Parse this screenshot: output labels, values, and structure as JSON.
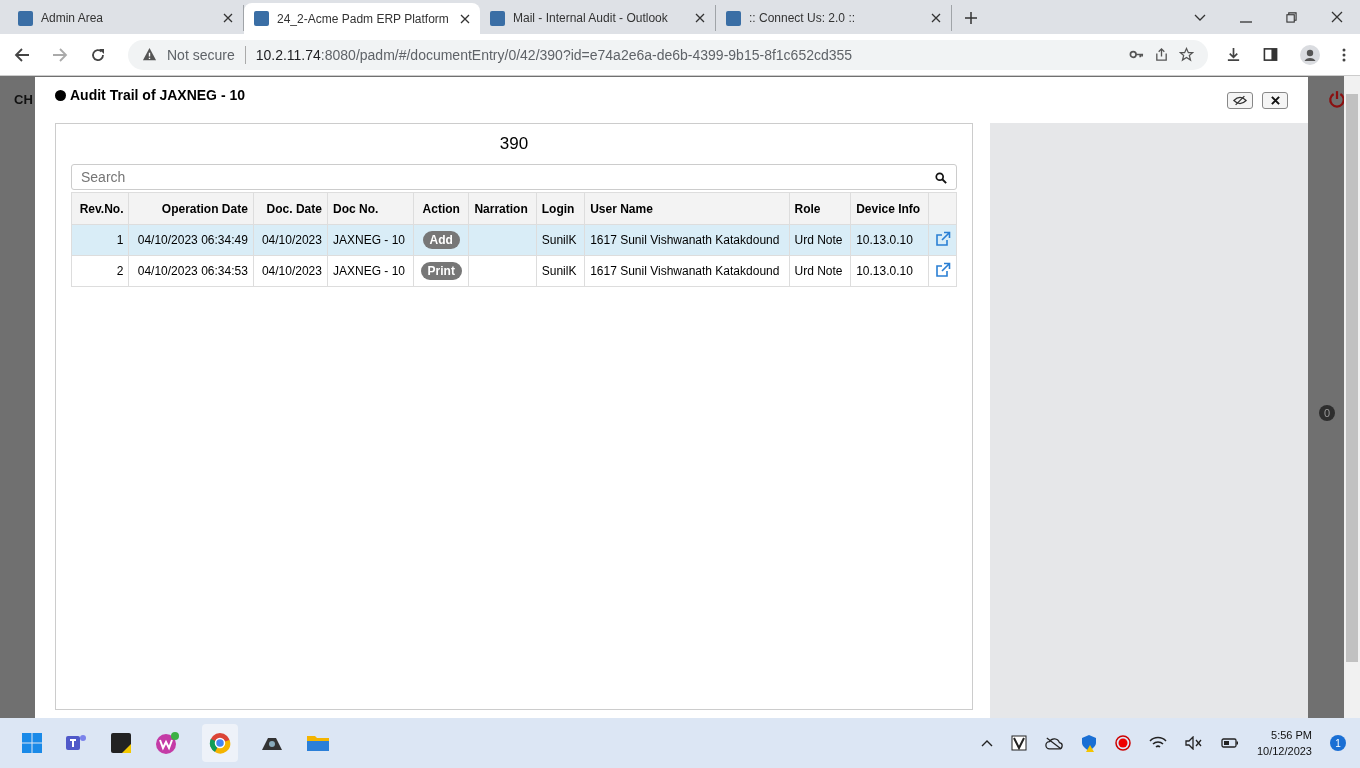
{
  "browser": {
    "tabs": [
      {
        "title": "Admin Area",
        "selected": false
      },
      {
        "title": "24_2-Acme Padm ERP Platform",
        "selected": true
      },
      {
        "title": "Mail - Internal Audit - Outlook",
        "selected": false
      },
      {
        "title": ":: Connect Us: 2.0 ::",
        "selected": false
      }
    ],
    "security": "Not secure",
    "url_host": "10.2.11.74",
    "url_path": ":8080/padm/#/documentEntry/0/42/390?id=e74a2e6a-de6b-4399-9b15-8f1c652cd355"
  },
  "background_page": {
    "header_text": "CH",
    "badge": "0"
  },
  "dialog": {
    "title": "Audit Trail of JAXNEG - 10",
    "heading": "390",
    "search": {
      "placeholder": "Search"
    },
    "table": {
      "columns": [
        "Rev.No.",
        "Operation Date",
        "Doc. Date",
        "Doc No.",
        "Action",
        "Narration",
        "Login",
        "User Name",
        "Role",
        "Device Info"
      ],
      "rows": [
        {
          "selected": true,
          "cells": [
            "1",
            "04/10/2023 06:34:49",
            "04/10/2023",
            "JAXNEG - 10",
            "Add",
            "",
            "SunilK",
            "1617 Sunil Vishwanath Katakdound",
            "Urd Note",
            "10.13.0.10"
          ]
        },
        {
          "selected": false,
          "cells": [
            "2",
            "04/10/2023 06:34:53",
            "04/10/2023",
            "JAXNEG - 10",
            "Print",
            "",
            "SunilK",
            "1617 Sunil Vishwanath Katakdound",
            "Urd Note",
            "10.13.0.10"
          ]
        }
      ]
    }
  },
  "taskbar": {
    "time": "5:56 PM",
    "date": "10/12/2023",
    "notifications": "1"
  }
}
